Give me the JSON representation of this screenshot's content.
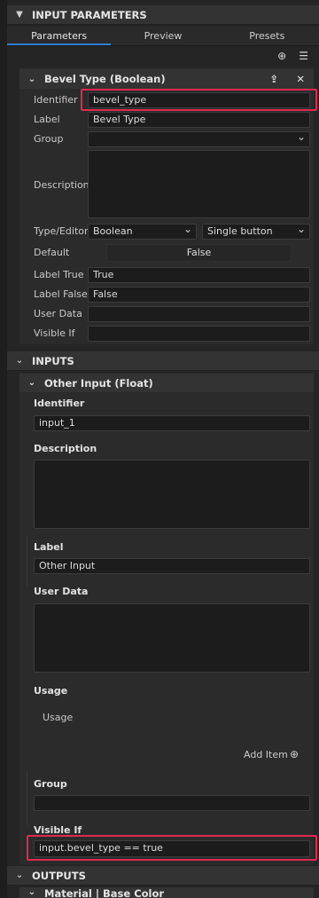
{
  "header": {
    "title": "INPUT PARAMETERS"
  },
  "tabs": [
    {
      "label": "Parameters",
      "active": true
    },
    {
      "label": "Preview",
      "active": false
    },
    {
      "label": "Presets",
      "active": false
    }
  ],
  "toolbar": {
    "add_icon": "plus-circle-icon",
    "menu_icon": "list-menu-icon"
  },
  "parameter": {
    "title": "Bevel Type (Boolean)",
    "fields": {
      "identifier": {
        "label": "Identifier",
        "value": "bevel_type"
      },
      "label": {
        "label": "Label",
        "value": "Bevel Type"
      },
      "group": {
        "label": "Group",
        "value": ""
      },
      "description": {
        "label": "Description",
        "value": ""
      },
      "type_editor": {
        "label": "Type/Editor",
        "type": "Boolean",
        "editor": "Single button"
      },
      "default": {
        "label": "Default",
        "value": "False"
      },
      "label_true": {
        "label": "Label True",
        "value": "True"
      },
      "label_false": {
        "label": "Label False",
        "value": "False"
      },
      "user_data": {
        "label": "User Data",
        "value": ""
      },
      "visible_if": {
        "label": "Visible If",
        "value": ""
      }
    }
  },
  "inputs": {
    "title": "INPUTS",
    "item": {
      "title": "Other Input (Float)",
      "identifier": {
        "label": "Identifier",
        "value": "input_1"
      },
      "description": {
        "label": "Description",
        "value": ""
      },
      "label": {
        "label": "Label",
        "value": "Other Input"
      },
      "user_data": {
        "label": "User Data",
        "value": ""
      },
      "usage": {
        "label": "Usage",
        "item": "Usage",
        "add_label": "Add Item"
      },
      "group": {
        "label": "Group",
        "value": ""
      },
      "visible_if": {
        "label": "Visible If",
        "value": "input.bevel_type == true"
      }
    }
  },
  "outputs": {
    "title": "OUTPUTS",
    "next_item": "Material | Base Color"
  },
  "colors": {
    "accent": "#2f7fd2",
    "highlight": "#e0294f"
  }
}
